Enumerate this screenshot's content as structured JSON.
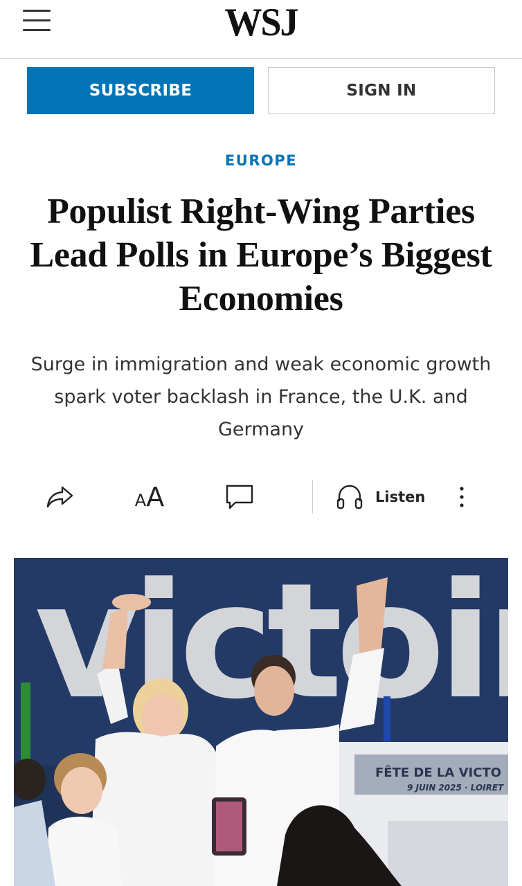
{
  "header": {
    "logo": "WSJ",
    "menu_icon": "hamburger-menu-icon"
  },
  "auth": {
    "subscribe_label": "SUBSCRIBE",
    "signin_label": "SIGN IN"
  },
  "article": {
    "section": "EUROPE",
    "headline": "Populist Right-Wing Parties Lead Polls in Europe’s Biggest Economies",
    "dek": "Surge in immigration and weak economic growth spark voter backlash in France, the U.K. and Germany"
  },
  "toolbar": {
    "share_icon": "share-arrow-icon",
    "text_size_label": "AA",
    "comment_icon": "comment-bubble-icon",
    "listen_icon": "headphones-icon",
    "listen_label": "Listen",
    "more_icon": "more-vertical-icon"
  },
  "photo": {
    "backdrop_text": "victoire",
    "podium_line1": "FÊTE DE LA VICTO",
    "podium_line2": "9 JUIN 2025 · LOIRET"
  },
  "colors": {
    "accent": "#0274b6",
    "text": "#111111",
    "backdrop": "#243a66"
  }
}
